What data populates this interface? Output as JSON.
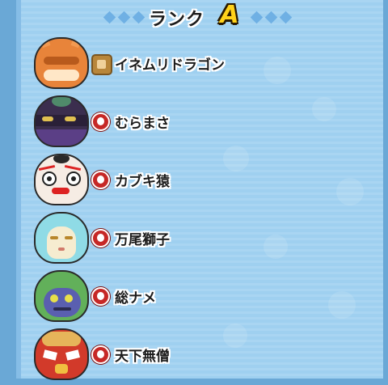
{
  "header": {
    "title": "ランク",
    "rank_letter": "A"
  },
  "colors": {
    "panel": "#9fd0f0",
    "rank_letter": "#ffd21a",
    "tribe_fire": "#c62826",
    "tribe_fist": "#b8863a"
  },
  "entries": [
    {
      "name": "イネムリドラゴン",
      "tribe_icon": "fist-icon"
    },
    {
      "name": "むらまさ",
      "tribe_icon": "fire-icon"
    },
    {
      "name": "カブキ猿",
      "tribe_icon": "fire-icon"
    },
    {
      "name": "万尾獅子",
      "tribe_icon": "fire-icon"
    },
    {
      "name": "総ナメ",
      "tribe_icon": "fire-icon"
    },
    {
      "name": "天下無僧",
      "tribe_icon": "fire-icon"
    }
  ]
}
